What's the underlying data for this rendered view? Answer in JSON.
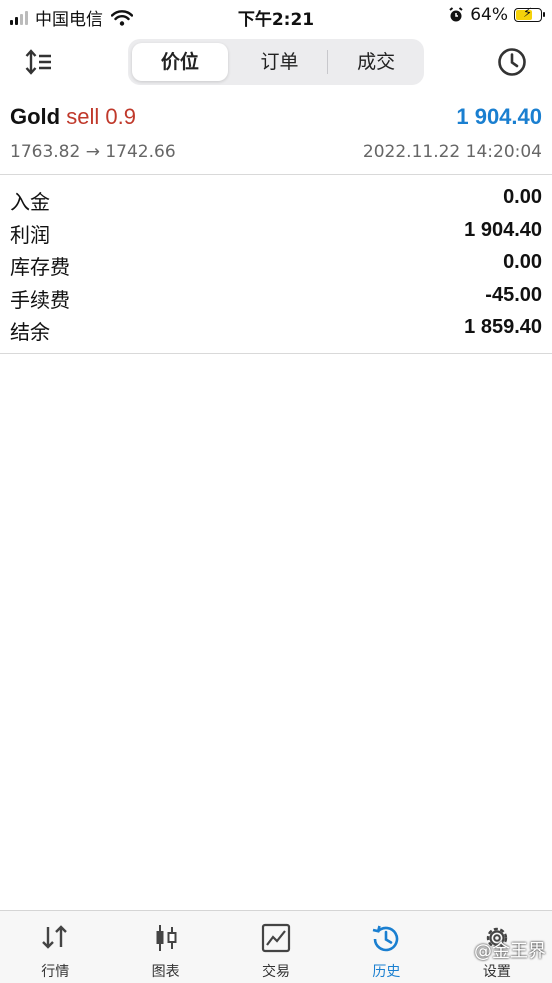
{
  "status_bar": {
    "carrier": "中国电信",
    "time": "下午2:21",
    "battery": "64%"
  },
  "toolbar": {
    "tabs": [
      "价位",
      "订单",
      "成交"
    ],
    "active_tab": "价位"
  },
  "deal": {
    "symbol": "Gold",
    "side": "sell 0.9",
    "profit": "1 904.40",
    "prices": "1763.82 → 1742.66",
    "time": "2022.11.22 14:20:04"
  },
  "summary": [
    {
      "label": "入金",
      "value": "0.00"
    },
    {
      "label": "利润",
      "value": "1 904.40"
    },
    {
      "label": "库存费",
      "value": "0.00"
    },
    {
      "label": "手续费",
      "value": "-45.00"
    },
    {
      "label": "结余",
      "value": "1 859.40"
    }
  ],
  "tabbar": {
    "items": [
      {
        "label": "行情",
        "icon": "quotes-arrows-icon"
      },
      {
        "label": "图表",
        "icon": "candlestick-icon"
      },
      {
        "label": "交易",
        "icon": "trade-chart-icon"
      },
      {
        "label": "历史",
        "icon": "history-clock-icon"
      },
      {
        "label": "设置",
        "icon": "gear-icon"
      }
    ],
    "active": "历史"
  },
  "watermark": "@金王界",
  "colors": {
    "accent": "#1a7fd0",
    "sell": "#c0392b"
  }
}
